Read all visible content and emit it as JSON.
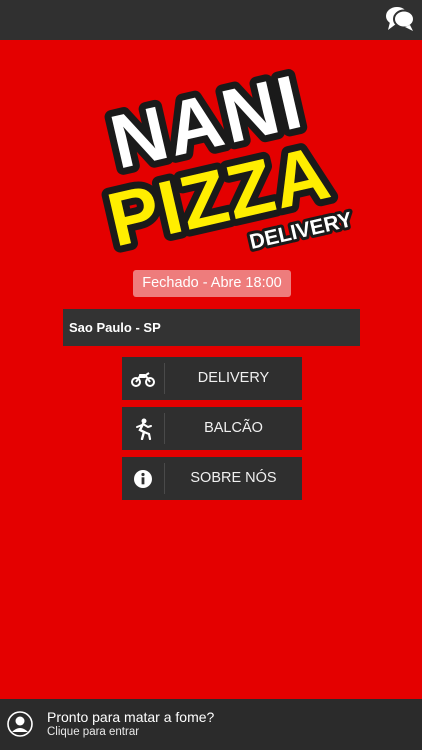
{
  "header": {
    "chat_icon": "chat-bubbles-icon"
  },
  "logo": {
    "line1": "NANI",
    "line2": "PIZZA",
    "line3": "DELIVERY",
    "colors": {
      "text_white": "#ffffff",
      "text_yellow": "#ffee00",
      "outline": "#1a1a1a"
    }
  },
  "status": {
    "label": "Fechado - Abre 18:00"
  },
  "location": {
    "city": "Sao Paulo - SP"
  },
  "menu": {
    "items": [
      {
        "label": "DELIVERY",
        "icon": "motorcycle-icon"
      },
      {
        "label": "BALCÃO",
        "icon": "running-person-icon"
      },
      {
        "label": "SOBRE NÓS",
        "icon": "info-icon"
      }
    ]
  },
  "footer": {
    "title": "Pronto para matar a fome?",
    "subtitle": "Clique para entrar",
    "icon": "user-icon"
  },
  "colors": {
    "background": "#e40000",
    "bar": "#303030",
    "button": "#2f2f2f",
    "status_bg": "#ee7c7c"
  }
}
